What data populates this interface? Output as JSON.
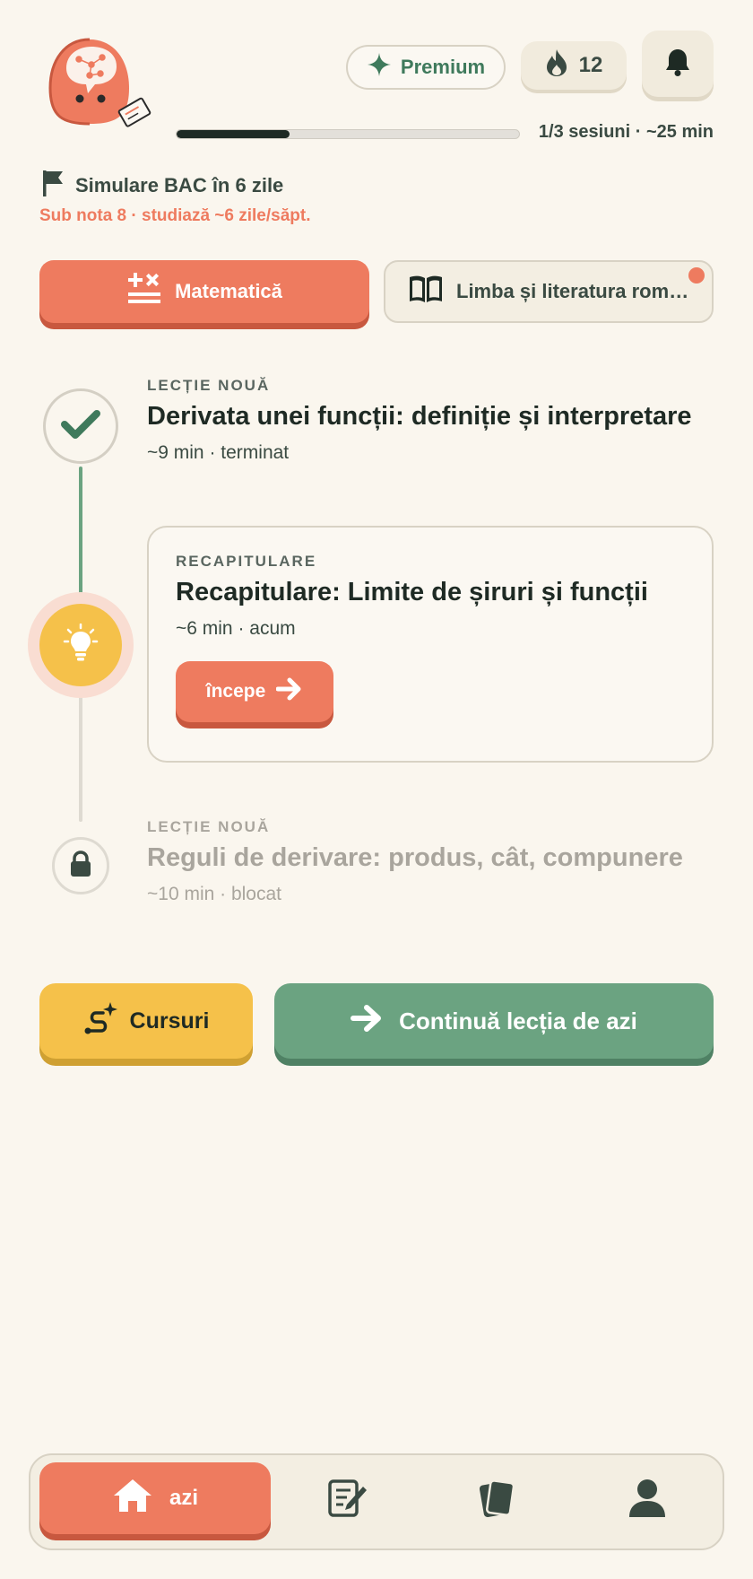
{
  "header": {
    "premium_label": "Premium",
    "streak_count": "12",
    "progress_fraction": 0.33,
    "progress_text": "1/3 sesiuni · ~25 min"
  },
  "goal": {
    "title": "Simulare BAC în 6 zile",
    "subtitle": "Sub nota 8 · studiază ~6 zile/săpt."
  },
  "subjects": [
    {
      "label": "Matematică",
      "active": true
    },
    {
      "label": "Limba și literatura română",
      "active": false,
      "has_notification": true
    }
  ],
  "lessons": [
    {
      "tag": "LECȚIE NOUĂ",
      "title": "Derivata unei funcții: definiție și interpretare",
      "meta": "~9 min · terminat",
      "status": "done"
    },
    {
      "tag": "RECAPITULARE",
      "title": "Recapitulare: Limite de șiruri și funcții",
      "meta": "~6 min · acum",
      "status": "current",
      "button_label": "începe"
    },
    {
      "tag": "LECȚIE NOUĂ",
      "title": "Reguli de derivare: produs, cât, compunere",
      "meta": "~10 min · blocat",
      "status": "locked"
    }
  ],
  "actions": {
    "courses_label": "Cursuri",
    "continue_label": "Continuă lecția de azi"
  },
  "nav": {
    "home_label": "azi",
    "items": [
      "home-icon",
      "notes-icon",
      "cards-icon",
      "profile-icon"
    ]
  },
  "colors": {
    "accent": "#EE7B5F",
    "green": "#6BA381",
    "yellow": "#F5C14A",
    "background": "#FAF6EE",
    "dark": "#1E2A24"
  }
}
